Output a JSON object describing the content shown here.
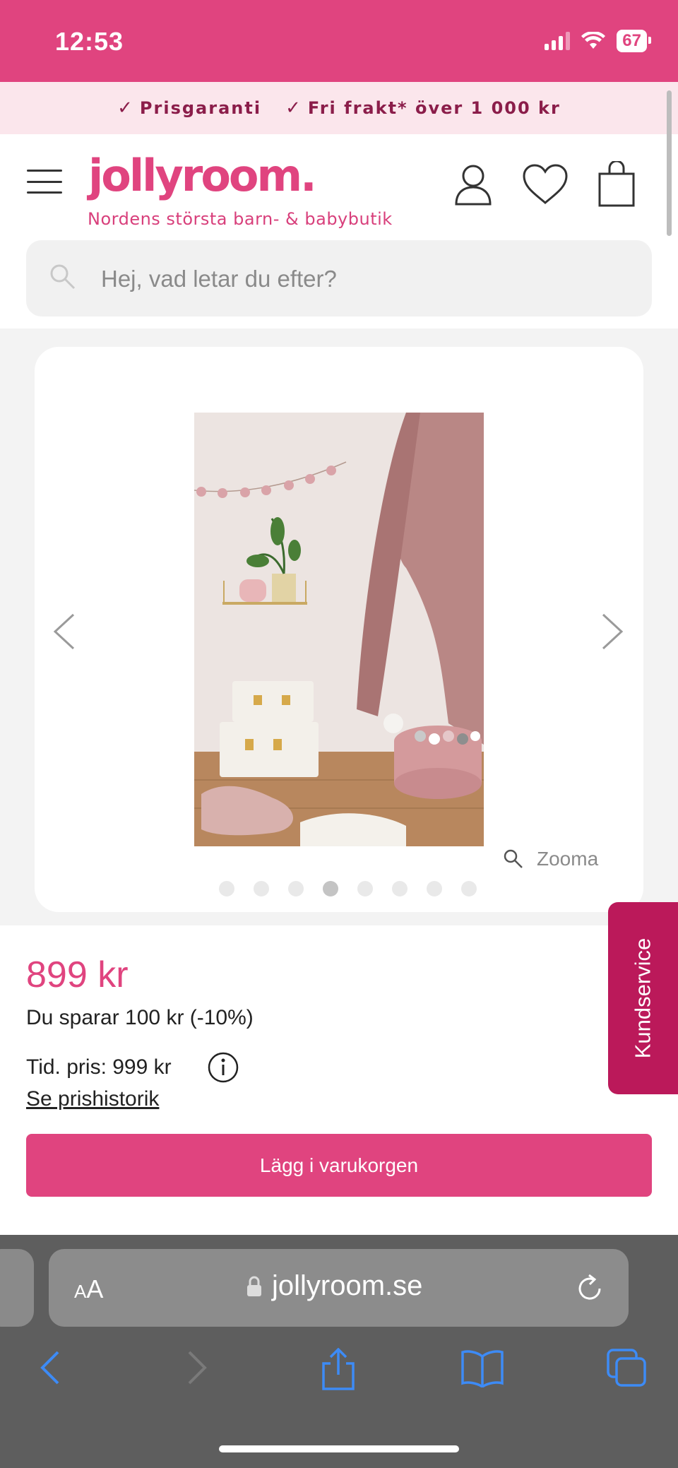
{
  "status_bar": {
    "time": "12:53",
    "battery": "67"
  },
  "promo": {
    "items": [
      "Prisgaranti",
      "Fri frakt* över 1 000 kr"
    ]
  },
  "header": {
    "logo": "jollyroom.",
    "tagline": "Nordens största barn- & babybutik",
    "search_placeholder": "Hej, vad letar du efter?"
  },
  "gallery": {
    "zoom_label": "Zooma",
    "dot_count": 8,
    "active_dot": 4
  },
  "product": {
    "price": "899 kr",
    "savings": "Du sparar 100 kr (-10%)",
    "previous_price": "Tid. pris: 999 kr",
    "price_history_link": "Se prishistorik",
    "add_to_cart": "Lägg i varukorgen"
  },
  "kundservice": {
    "label": "Kundservice"
  },
  "browser": {
    "text_size_small": "A",
    "text_size_big": "A",
    "url": "jollyroom.se"
  },
  "colors": {
    "brand": "#e0447f",
    "kundservice": "#bb195a",
    "promo_bg": "#fbe6ec"
  }
}
